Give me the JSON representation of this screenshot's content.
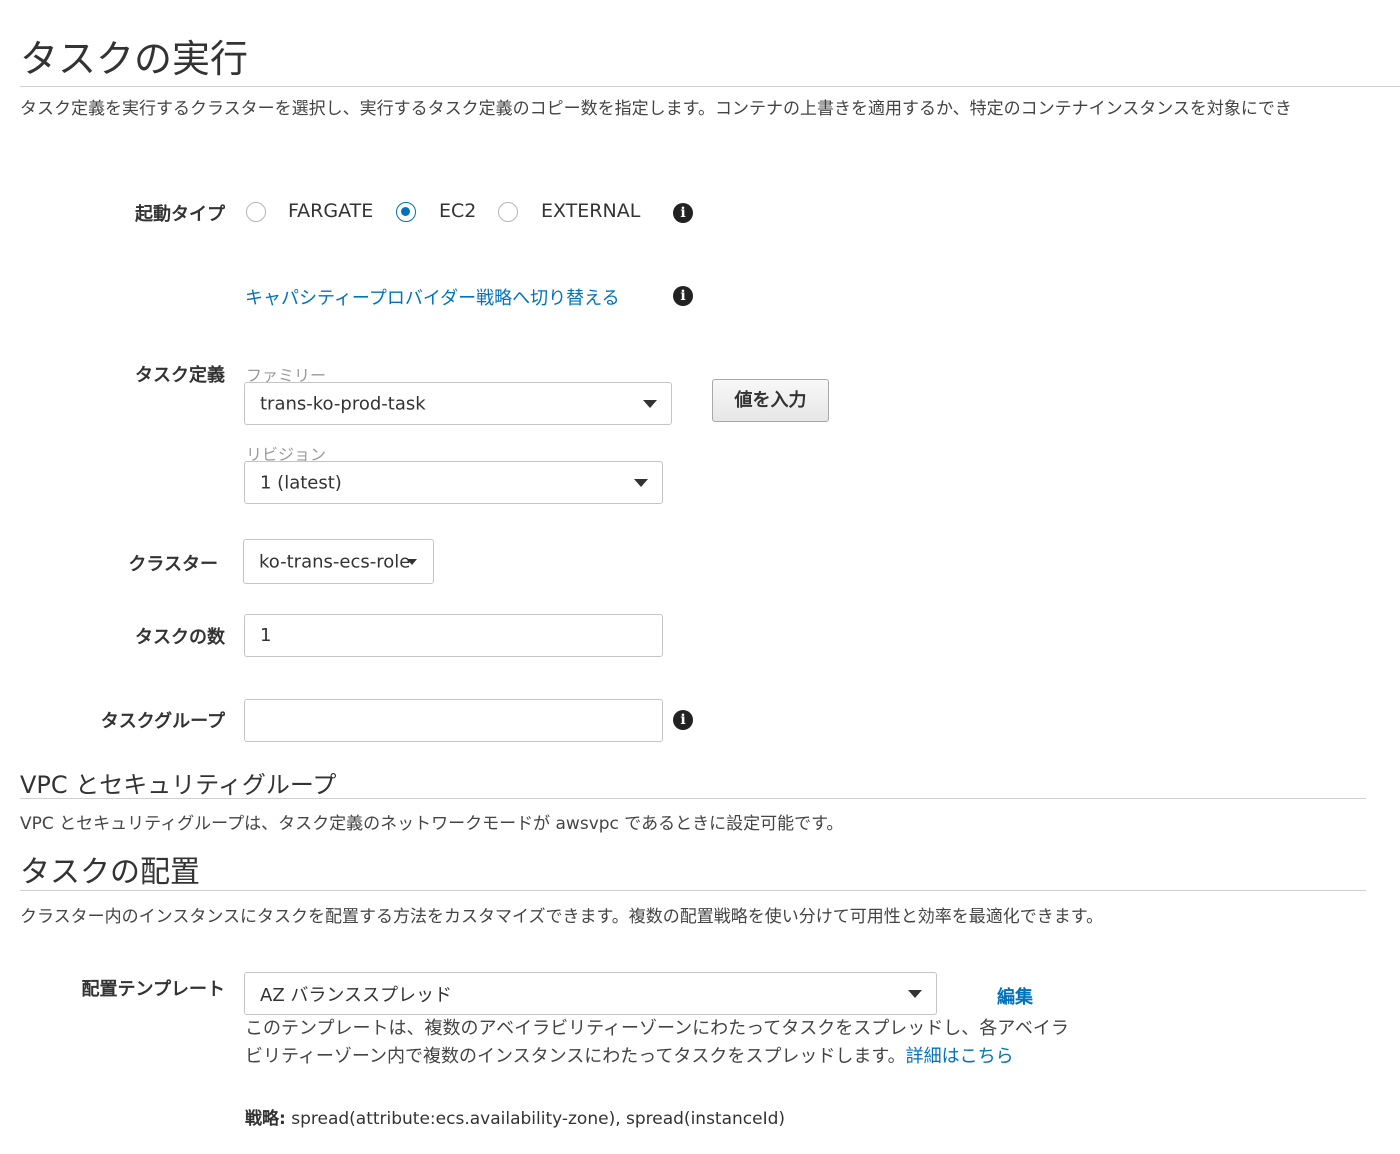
{
  "page": {
    "title": "タスクの実行",
    "description": "タスク定義を実行するクラスターを選択し、実行するタスク定義のコピー数を指定します。コンテナの上書きを適用するか、特定のコンテナインスタンスを対象にでき"
  },
  "launch_type": {
    "label": "起動タイプ",
    "options": [
      {
        "label": "FARGATE",
        "checked": false
      },
      {
        "label": "EC2",
        "checked": true
      },
      {
        "label": "EXTERNAL",
        "checked": false
      }
    ]
  },
  "capacity_provider_link": "キャパシティープロバイダー戦略へ切り替える",
  "task_definition": {
    "label": "タスク定義",
    "family_label": "ファミリー",
    "family_value": "trans-ko-prod-task",
    "enter_value_button": "値を入力",
    "revision_label": "リビジョン",
    "revision_value": "1 (latest)"
  },
  "cluster": {
    "label": "クラスター",
    "value": "ko-trans-ecs-role"
  },
  "task_count": {
    "label": "タスクの数",
    "value": "1"
  },
  "task_group": {
    "label": "タスクグループ",
    "value": ""
  },
  "vpc": {
    "heading": "VPC とセキュリティグループ",
    "description": "VPC とセキュリティグループは、タスク定義のネットワークモードが awsvpc であるときに設定可能です。"
  },
  "placement": {
    "heading": "タスクの配置",
    "description": "クラスター内のインスタンスにタスクを配置する方法をカスタマイズできます。複数の配置戦略を使い分けて可用性と効率を最適化できます。",
    "template_label": "配置テンプレート",
    "template_value": "AZ バランススプレッド",
    "edit_link": "編集",
    "help_text": "このテンプレートは、複数のアベイラビリティーゾーンにわたってタスクをスプレッドし、各アベイラビリティーゾーン内で複数のインスタンスにわたってタスクをスプレッドします。",
    "learn_more_link": "詳細はこちら",
    "strategy_label": "戦略:",
    "strategy_value": " spread(attribute:ecs.availability-zone), spread(instanceId)"
  },
  "colors": {
    "link": "#0073bb",
    "radio_checked": "#0073bb",
    "text": "#333333"
  },
  "icons": {
    "info": "info-icon",
    "dropdown": "caret-down-icon"
  }
}
